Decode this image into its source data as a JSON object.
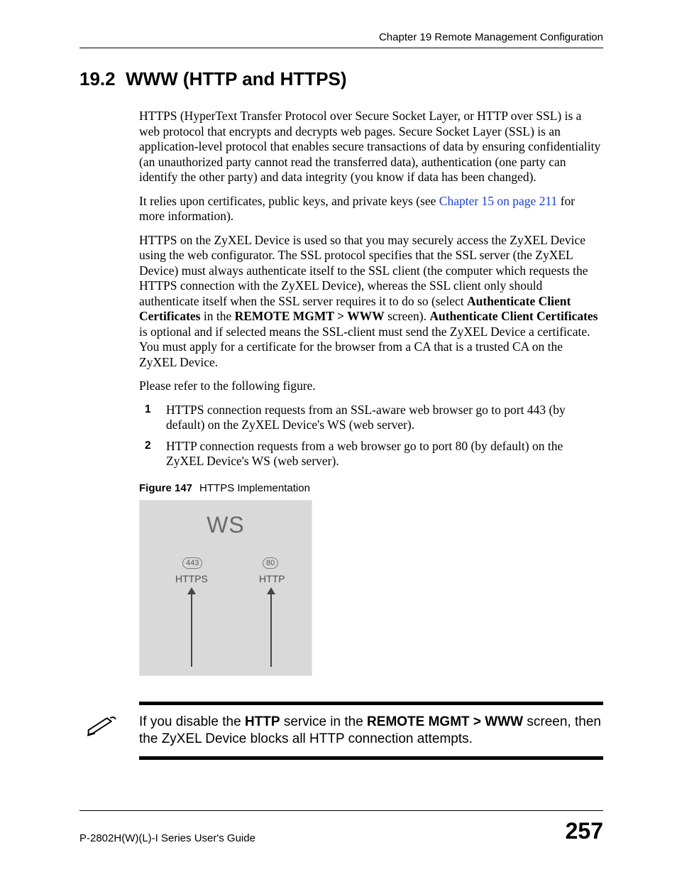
{
  "header": {
    "chapter": "Chapter 19 Remote Management Configuration"
  },
  "section": {
    "number": "19.2",
    "title": "WWW (HTTP and HTTPS)"
  },
  "paragraphs": {
    "p1": "HTTPS (HyperText Transfer Protocol over Secure Socket Layer, or HTTP over SSL) is a web protocol that encrypts and decrypts web pages. Secure Socket Layer (SSL) is an application-level protocol that enables secure transactions of data by ensuring confidentiality (an unauthorized party cannot read the transferred data), authentication (one party can identify the other party) and data integrity (you know if data has been changed).",
    "p2_before": "It relies upon certificates, public keys, and private keys (see ",
    "p2_link": "Chapter 15 on page 211",
    "p2_after": " for more information).",
    "p3_a": "HTTPS on the ZyXEL Device is used so that you may securely access the ZyXEL Device using the web configurator. The SSL protocol specifies that the SSL server (the ZyXEL Device) must always authenticate itself to the SSL client (the computer which requests the HTTPS connection with the ZyXEL Device), whereas the SSL client only should authenticate itself when the SSL server requires it to do so (select ",
    "p3_b": "Authenticate Client Certificates",
    "p3_c": " in the ",
    "p3_d": "REMOTE MGMT > WWW",
    "p3_e": " screen). ",
    "p3_f": "Authenticate Client Certificates",
    "p3_g": " is optional and if selected means the SSL-client must send the ZyXEL Device a certificate. You must apply for a certificate for the browser from a CA that is a trusted CA on the ZyXEL Device.",
    "p4": "Please refer to the following figure."
  },
  "list": {
    "i1": "HTTPS connection requests from an SSL-aware web browser go to port 443 (by default) on the ZyXEL Device's WS (web server).",
    "i2": "HTTP connection requests from a web browser go to port 80 (by default) on the ZyXEL Device's WS (web server)."
  },
  "figure": {
    "label": "Figure 147",
    "caption": "HTTPS Implementation",
    "ws": "WS",
    "port443": "443",
    "port80": "80",
    "https": "HTTPS",
    "http": "HTTP"
  },
  "note": {
    "t1": "If you disable the ",
    "b1": "HTTP",
    "t2": " service in the ",
    "b2": "REMOTE MGMT > WWW",
    "t3": " screen, then the ZyXEL Device blocks all HTTP connection attempts."
  },
  "footer": {
    "guide": "P-2802H(W)(L)-I Series User's Guide",
    "page": "257"
  }
}
